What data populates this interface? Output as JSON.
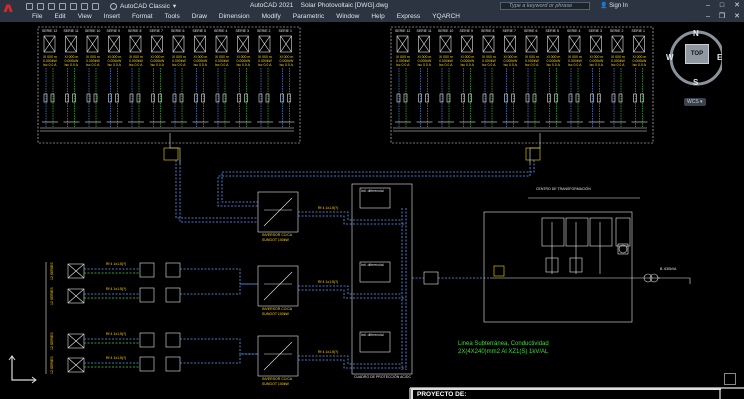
{
  "window": {
    "app_name": "AutoCAD 2021",
    "doc_title": "Solar Photovoltaic [DWG].dwg",
    "workspace": "AutoCAD Classic",
    "search_placeholder": "Type a keyword or phrase",
    "sign_in": "Sign In"
  },
  "menu": {
    "items": [
      "File",
      "Edit",
      "View",
      "Insert",
      "Format",
      "Tools",
      "Draw",
      "Dimension",
      "Modify",
      "Parametric",
      "Window",
      "Help",
      "Express",
      "YQARCH"
    ]
  },
  "viewcube": {
    "face": "TOP",
    "north": "N",
    "south": "S",
    "east": "E",
    "west": "W",
    "wcs": "WCS"
  },
  "drawing": {
    "left_array_series": [
      "SERIE 12",
      "SERIE 11",
      "SERIE 10",
      "SERIE 9",
      "SERIE 8",
      "SERIE 7",
      "SERIE 6",
      "SERIE 5",
      "SERIE 4",
      "SERIE 3",
      "SERIE 2",
      "SERIE 1"
    ],
    "right_array_series": [
      "SERIE 12",
      "SERIE 11",
      "SERIE 10",
      "SERIE 9",
      "SERIE 8",
      "SERIE 7",
      "SERIE 6",
      "SERIE 5",
      "SERIE 4",
      "SERIE 3",
      "SERIE 2",
      "SERIE 1"
    ],
    "inverter_label": "INVERSOR CC/CA",
    "inverter_labels": [
      "INVERSOR CC/CA",
      "INVERSOR CC/CA",
      "INVERSOR CC/CA"
    ],
    "left_series_labels": [
      "12 SERIES",
      "12 SERIES",
      "12 SERIES",
      "12 SERIES"
    ],
    "cable_note_1": "Linea Subterránea, Conductividad",
    "cable_note_2": "2X(4X240)mm2 Al XZ1(S) 1kV/AL",
    "proyecto": "PROYECTO DE:",
    "cabinet_caption": "CUADRO DE PROTECCIÓN AC/DC"
  },
  "colors": {
    "titlebar_bg": "#2b3440",
    "canvas_bg": "#000000",
    "line_white": "#e7e7e7",
    "line_green": "#3ddb3d",
    "line_yellow": "#ffd800",
    "line_blue": "#5aa0ff",
    "brand_red": "#e0242b"
  }
}
